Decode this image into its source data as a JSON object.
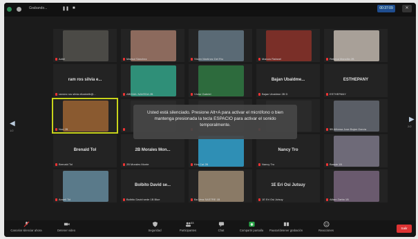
{
  "topbar": {
    "title": "Grabando...",
    "pause_icon": "pause-icon",
    "stop_icon": "stop-icon",
    "time": "00:37:09",
    "close_label": "✕"
  },
  "tiles": [
    {
      "id": "t1",
      "name": "",
      "label": "Adiel",
      "photo": "#4b4a46"
    },
    {
      "id": "t2",
      "name": "",
      "label": "Marisol Sánchez",
      "photo": "#8c6a5d"
    },
    {
      "id": "t3",
      "name": "",
      "label": "Stiven Martínez Del Río",
      "photo": "#5a6a75"
    },
    {
      "id": "t4",
      "name": "",
      "label": "Marcos Rafanel",
      "photo": "#7a2f28"
    },
    {
      "id": "t5",
      "name": "",
      "label": "Rebeca Mancilla 2B",
      "photo": "#a8a098"
    },
    {
      "id": "t6",
      "name": "ram ros silvia e...",
      "label": "ramrez ros silvia elizabeth@...",
      "photo": ""
    },
    {
      "id": "t7",
      "name": "",
      "label": "ABIGAIL NAVEDA 2B",
      "photo": "#2f8f78"
    },
    {
      "id": "t8",
      "name": "",
      "label": "Víctor Gabriel",
      "photo": "#2d6b3d"
    },
    {
      "id": "t9",
      "name": "Bajan Ubaldme...",
      "label": "Bajan Ubaldme 2B D",
      "photo": ""
    },
    {
      "id": "t10",
      "name": "ESTHEPANY",
      "label": "ESTHEPANY",
      "photo": ""
    },
    {
      "id": "t11",
      "name": "",
      "label": "Noe 2B",
      "photo": "#8a5a30",
      "active": true
    },
    {
      "id": "t12",
      "name": "",
      "label": "",
      "photo": "#2a2a2a"
    },
    {
      "id": "t13",
      "name": "",
      "label": "",
      "photo": "#2a2a2a"
    },
    {
      "id": "t14",
      "name": "",
      "label": "",
      "photo": "#2a2a2a"
    },
    {
      "id": "t15",
      "name": "",
      "label": "5B Alfonsa Jose Bajan García",
      "photo": "#5a5e66"
    },
    {
      "id": "t16",
      "name": "Brenald Tol",
      "label": "Brenald Tol",
      "photo": ""
    },
    {
      "id": "t17",
      "name": "2B Morales Mon...",
      "label": "2B Morales Monte",
      "photo": ""
    },
    {
      "id": "t18",
      "name": "",
      "label": "Kim Cat 2B",
      "photo": "#2f8fb5"
    },
    {
      "id": "t19",
      "name": "Nancy Tro",
      "label": "Nancy Tro",
      "photo": ""
    },
    {
      "id": "t20",
      "name": "",
      "label": "Bassie 1B",
      "photo": "#6e6a78"
    },
    {
      "id": "t21",
      "name": "",
      "label": "Anneli Tol",
      "photo": "#5a7a8a"
    },
    {
      "id": "t22",
      "name": "Bolbito David se...",
      "label": "Bolbito David sede 1B Blue",
      "photo": ""
    },
    {
      "id": "t23",
      "name": "",
      "label": "Ba Vera SASTRE 1B",
      "photo": "#8a7a66"
    },
    {
      "id": "t24",
      "name": "1E Eri Osi Jutsuy",
      "label": "1E Eri Osi Jutsuy",
      "photo": ""
    },
    {
      "id": "t25",
      "name": "",
      "label": "Alfaro Zarita 1B",
      "photo": "#6a5a6e"
    }
  ],
  "nav": {
    "prev": "◀",
    "next": "▶",
    "prev_page": "1/2",
    "next_page": "2/2"
  },
  "toast": {
    "message": "Usted está silenciado. Presione Alt+A para activar el micrófono o bien mantenga presionada la tecla ESPACIO para activar el sonido temporalmente."
  },
  "toolbar": {
    "items": [
      {
        "id": "mute",
        "label": "Cancelar silenciar ahora",
        "icon": "mic-icon"
      },
      {
        "id": "video",
        "label": "Detener video",
        "icon": "video-icon"
      },
      {
        "id": "security",
        "label": "Seguridad",
        "icon": "shield-icon"
      },
      {
        "id": "participants",
        "label": "Participantes",
        "icon": "participants-icon",
        "count": "33"
      },
      {
        "id": "chat",
        "label": "Chat",
        "icon": "chat-icon"
      },
      {
        "id": "share",
        "label": "Compartir pantalla",
        "icon": "share-icon"
      },
      {
        "id": "pause_record",
        "label": "Pausar/detener grabación",
        "icon": "record-icon"
      },
      {
        "id": "reactions",
        "label": "Reacciones",
        "icon": "smile-icon"
      }
    ],
    "leave_label": "Salir"
  },
  "colors": {
    "active_speaker": "#c9d41a",
    "share": "#2ba84a",
    "leave": "#dd3333"
  }
}
